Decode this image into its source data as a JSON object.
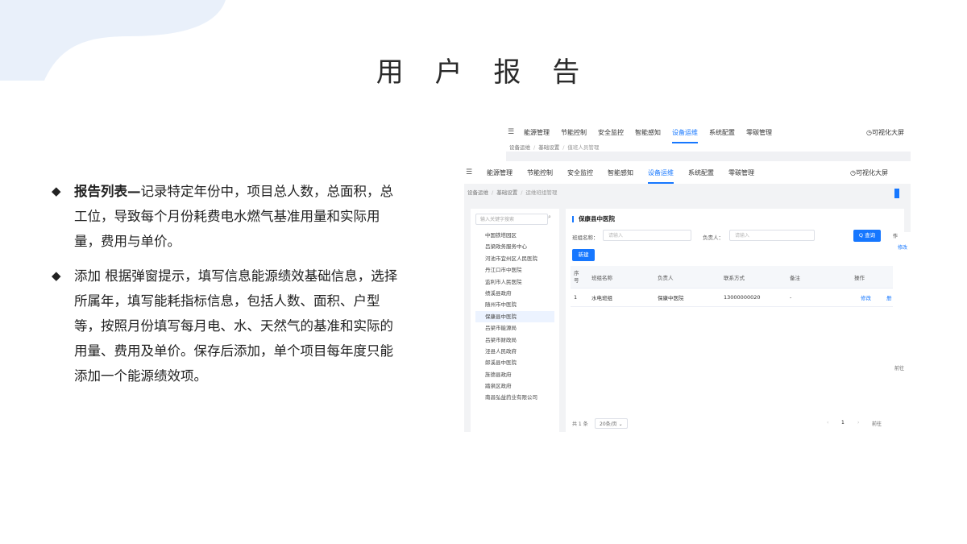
{
  "slide": {
    "title": "用 户 报 告",
    "bullets": [
      {
        "marker": "◆",
        "bold": "报告列表—",
        "text": "记录特定年份中，项目总人数，总面积，总工位，导致每个月份耗费电水燃气基准用量和实际用量，费用与单价。"
      },
      {
        "marker": "◆",
        "bold": "",
        "text": "添加 根据弹窗提示，填写信息能源绩效基础信息，选择所属年，填写能耗指标信息，包括人数、面积、户型等，按照月份填写每月电、水、天然气的基准和实际的用量、费用及单价。保存后添加，单个项目每年度只能添加一个能源绩效项。"
      }
    ]
  },
  "back_window": {
    "nav": [
      "能源管理",
      "节能控制",
      "安全监控",
      "智能感知",
      "设备运维",
      "系统配置",
      "零碳管理"
    ],
    "active_nav": "设备运维",
    "right_link": "◷可视化大屏",
    "breadcrumb": [
      "设备运维",
      "基础设置",
      "值班人员管理"
    ]
  },
  "front_window": {
    "nav": [
      "能源管理",
      "节能控制",
      "安全监控",
      "智能感知",
      "设备运维",
      "系统配置",
      "零碳管理"
    ],
    "active_nav": "设备运维",
    "right_link": "◷可视化大屏",
    "breadcrumb": [
      "设备运维",
      "基础设置",
      "运维班组管理"
    ],
    "tree": {
      "search_placeholder": "输入关键字搜索",
      "items": [
        "中国铁塔园区",
        "吕梁政务服务中心",
        "河池市宜州区人民医院",
        "丹江口市中医院",
        "监利市人民医院",
        "绩溪县政府",
        "随州市中医院",
        "保康县中医院",
        "吕梁市能源局",
        "吕梁市财政局",
        "泾县人民政府",
        "郎溪县中医院",
        "旌德县政府",
        "踏泉区政府",
        "南昌弘益药业有限公司"
      ],
      "selected": "保康县中医院"
    },
    "panel": {
      "title": "保康县中医院",
      "group_label": "班组名称：",
      "group_placeholder": "请输入",
      "owner_label": "负责人：",
      "owner_placeholder": "请输入",
      "query_button": "Q 查询",
      "new_button": "新建",
      "columns": [
        "序\n号",
        "班组名称",
        "负责人",
        "联系方式",
        "备注",
        "操作"
      ],
      "rows": [
        {
          "no": "1",
          "name": "水电班组",
          "owner": "保康中医院",
          "phone": "13000000020",
          "note": "-",
          "edit": "修改",
          "more": "册"
        }
      ],
      "total": "共 1 条",
      "page_size": "20条/页",
      "page": "1",
      "goto": "前往"
    },
    "edge": {
      "op": "作",
      "edit": "修改",
      "goto": "前往"
    }
  },
  "colors": {
    "accent": "#1677ff",
    "corner": "#e8f0fb"
  }
}
